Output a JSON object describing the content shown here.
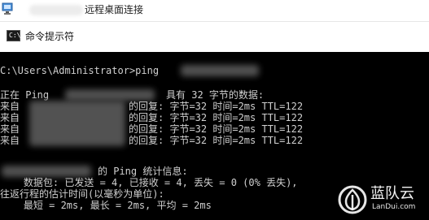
{
  "rdp_window": {
    "title": "远程桌面连接"
  },
  "cmd_window": {
    "icon_text": "C:\\",
    "title": "命令提示符"
  },
  "console": {
    "prompt_line": "C:\\Users\\Administrator>ping",
    "pinging_prefix": "正在 Ping",
    "pinging_suffix": "具有 32 字节的数据:",
    "reply_prefix": "来自",
    "reply_lines": [
      "的回复: 字节=32 时间=2ms TTL=122",
      "的回复: 字节=32 时间=2ms TTL=122",
      "的回复: 字节=32 时间=2ms TTL=122",
      "的回复: 字节=32 时间=2ms TTL=122"
    ],
    "stats_header": "的 Ping 统计信息:",
    "packets_line": "    数据包: 已发送 = 4, 已接收 = 4, 丢失 = 0 (0% 丢失),",
    "rtt_header": "往返行程的估计时间(以毫秒为单位):",
    "rtt_line": "    最短 = 2ms, 最长 = 2ms, 平均 = 2ms"
  },
  "watermark": {
    "title": "蓝队云",
    "subtitle": "LanDui.com",
    "icon": "cloud-logo-icon"
  }
}
